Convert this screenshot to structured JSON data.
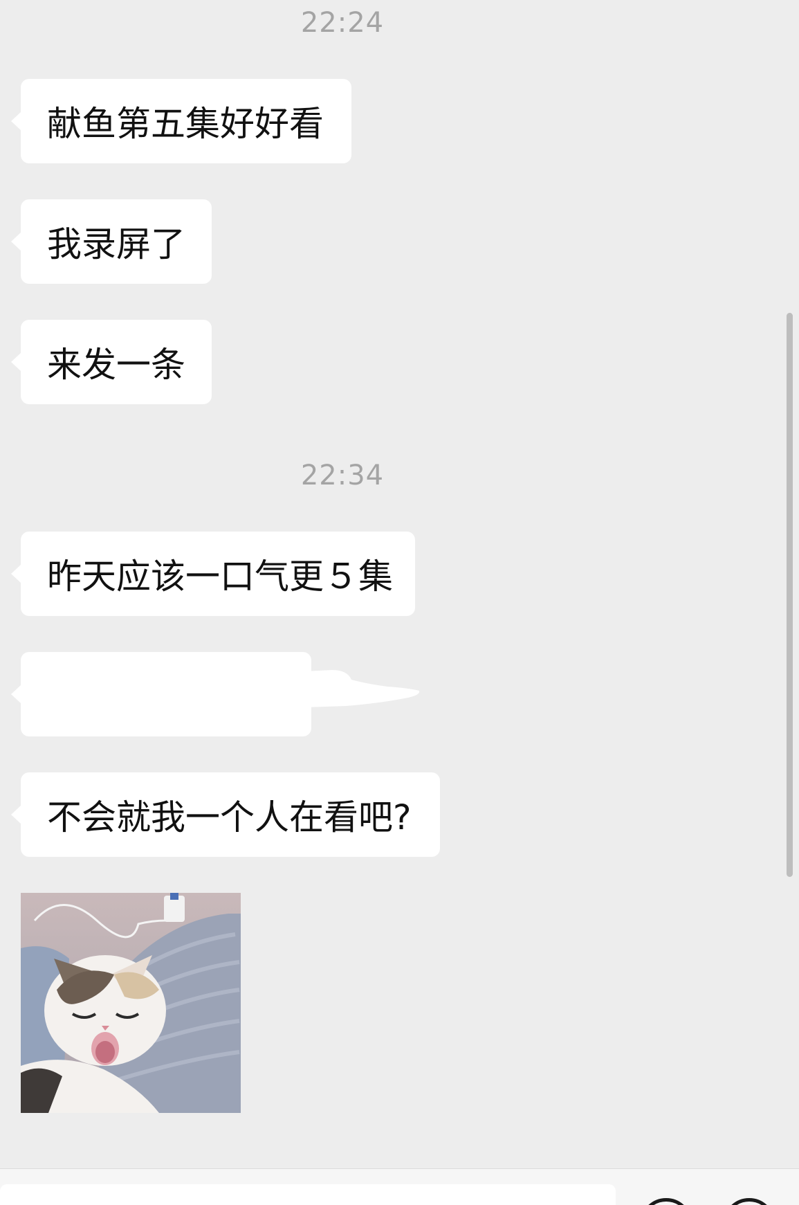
{
  "chat": {
    "timestamps": [
      "22:24",
      "22:34"
    ],
    "messages": [
      {
        "text": "献鱼第五集好好看"
      },
      {
        "text": "我录屏了"
      },
      {
        "text": "来发一条"
      },
      {
        "text": "昨天应该一口气更５集"
      },
      {
        "text": ""
      },
      {
        "text": "不会就我一个人在看吧?"
      }
    ],
    "sticker": {
      "description_icon": "sleepy-cat-sticker"
    }
  },
  "input_bar": {
    "buttons": [
      "emoji-icon",
      "plus-icon"
    ]
  },
  "colors": {
    "background": "#ededed",
    "bubble": "#ffffff",
    "timestamp": "#a4a4a4",
    "text": "#111111"
  }
}
